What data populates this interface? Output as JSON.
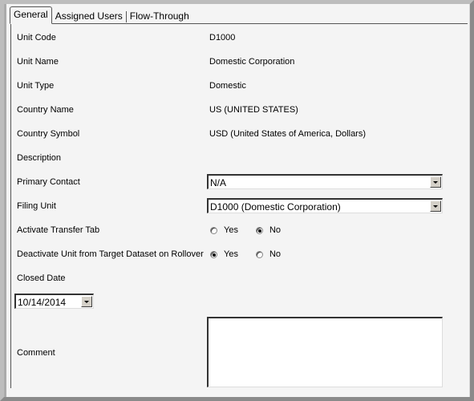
{
  "tabs": [
    {
      "label": "General",
      "active": true
    },
    {
      "label": "Assigned Users",
      "active": false
    },
    {
      "label": "Flow-Through",
      "active": false
    }
  ],
  "fields": {
    "unit_code": {
      "label": "Unit Code",
      "value": "D1000"
    },
    "unit_name": {
      "label": "Unit Name",
      "value": "Domestic Corporation"
    },
    "unit_type": {
      "label": "Unit Type",
      "value": "Domestic"
    },
    "country_name": {
      "label": "Country Name",
      "value": "US (UNITED STATES)"
    },
    "country_symbol": {
      "label": "Country Symbol",
      "value": "USD (United States of America, Dollars)"
    },
    "description": {
      "label": "Description",
      "value": ""
    },
    "primary_contact": {
      "label": "Primary Contact",
      "value": "N/A"
    },
    "filing_unit": {
      "label": "Filing Unit",
      "value": "D1000 (Domestic Corporation)"
    },
    "activate_transfer_tab": {
      "label": "Activate Transfer Tab",
      "options": [
        "Yes",
        "No"
      ],
      "selected": "No"
    },
    "deactivate_unit": {
      "label": "Deactivate Unit from Target Dataset on Rollover",
      "options": [
        "Yes",
        "No"
      ],
      "selected": "Yes"
    },
    "closed_date": {
      "label": "Closed Date",
      "value": "10/14/2014"
    },
    "comment": {
      "label": "Comment",
      "value": ""
    }
  }
}
